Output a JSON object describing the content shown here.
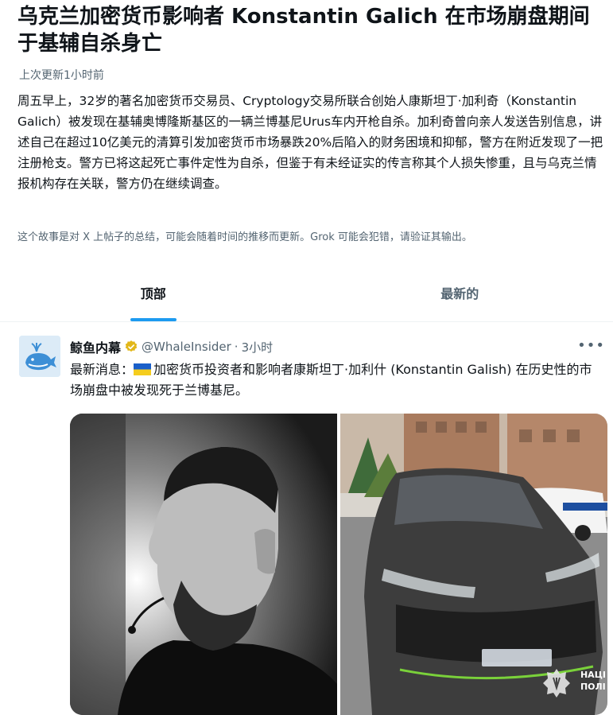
{
  "story": {
    "headline": "乌克兰加密货币影响者 Konstantin Galich 在市场崩盘期间于基辅自杀身亡",
    "updated": "上次更新1小时前",
    "summary": "周五早上，32岁的著名加密货币交易员、Cryptology交易所联合创始人康斯坦丁·加利奇（Konstantin Galich）被发现在基辅奥博隆斯基区的一辆兰博基尼Urus车内开枪自杀。加利奇曾向亲人发送告别信息，讲述自己在超过10亿美元的清算引发加密货币市场暴跌20%后陷入的财务困境和抑郁，警方在附近发现了一把注册枪支。警方已将这起死亡事件定性为自杀，但鉴于有未经证实的传言称其个人损失惨重，且与乌克兰情报机构存在关联，警方仍在继续调查。",
    "disclaimer": "这个故事是对 X 上帖子的总结，可能会随着时间的推移而更新。Grok 可能会犯错，请验证其输出。"
  },
  "tabs": [
    {
      "label": "顶部",
      "active": true
    },
    {
      "label": "最新的",
      "active": false
    }
  ],
  "post": {
    "author": "鲸鱼内幕",
    "handle": "@WhaleInsider",
    "separator": "·",
    "time": "3小时",
    "more": "•••",
    "text_prefix": "最新消息：",
    "text_body": "加密货币投资者和影响者康斯坦丁·加利什 (Konstantin Galish) 在历史性的市场崩盘中被发现死于兰博基尼。",
    "photo_watermark": "НАЦІ\nПОЛІ"
  },
  "colors": {
    "accent": "#1d9bf0",
    "verified": "#e2b719",
    "secondary_text": "#536471"
  },
  "icons": [
    "verified-badge-icon",
    "ukraine-flag-icon",
    "more-icon",
    "police-badge-icon"
  ]
}
